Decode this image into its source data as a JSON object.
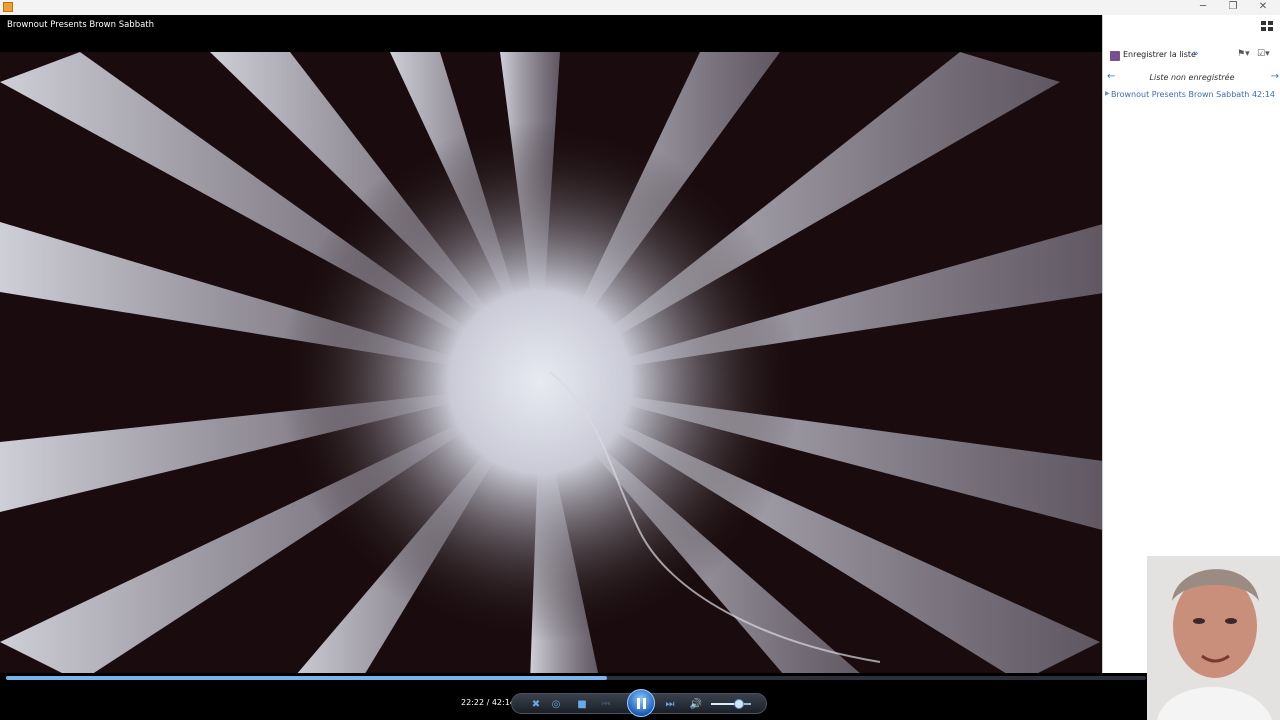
{
  "window": {
    "minimize_glyph": "─",
    "restore_glyph": "❐",
    "close_glyph": "✕"
  },
  "media": {
    "title": "Brownout Presents Brown Sabbath"
  },
  "playlist": {
    "save_label": "Enregistrer la liste",
    "more_glyph": "»",
    "name": "Liste non enregistrée",
    "items": [
      {
        "title": "Brownout Presents Brown Sabbath",
        "duration": "42:14"
      }
    ]
  },
  "player": {
    "time": "22:22 / 42:14",
    "progress": 0.527,
    "volume": 0.7,
    "state": "playing"
  },
  "icons": [
    "app-icon",
    "minimize-icon",
    "restore-icon",
    "close-icon",
    "switch-to-library-icon",
    "save-list-icon",
    "list-options-icon",
    "back-arrow-icon",
    "forward-arrow-icon",
    "shuffle-icon",
    "repeat-icon",
    "stop-icon",
    "previous-icon",
    "pause-icon",
    "next-icon",
    "mute-icon"
  ],
  "colors": {
    "accent": "#7ab4ea",
    "playlist_link": "#3a6fb5",
    "video_tint": "#1a0c0e"
  }
}
